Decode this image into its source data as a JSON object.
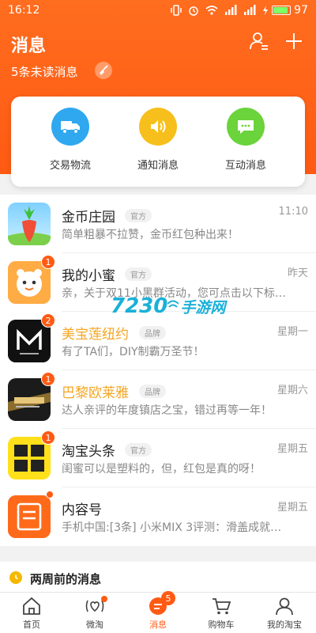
{
  "status_bar": {
    "time": "16:12",
    "battery": "97"
  },
  "header": {
    "title": "消息",
    "unread": "5条未读消息"
  },
  "quick_actions": [
    {
      "label": "交易物流",
      "color": "#2fa8f0",
      "icon": "truck-icon"
    },
    {
      "label": "通知消息",
      "color": "#f7bf1b",
      "icon": "speaker-icon"
    },
    {
      "label": "互动消息",
      "color": "#6bd33b",
      "icon": "chat-icon"
    }
  ],
  "messages": [
    {
      "name": "金币庄园",
      "tag": "官方",
      "time": "11:10",
      "preview": "简单粗暴不拉赞，金币红包种出来！",
      "badge": "",
      "dot": false,
      "highlight": false,
      "icon": "radish-icon"
    },
    {
      "name": "我的小蜜",
      "tag": "官方",
      "time": "昨天",
      "preview": "亲，关于双11小黑群活动，您可点击以下标…",
      "badge": "1",
      "dot": false,
      "highlight": false,
      "icon": "honey-mascot-icon"
    },
    {
      "name": "美宝莲纽约",
      "tag": "品牌",
      "time": "星期一",
      "preview": "有了TA们，DIY制霸万圣节！",
      "badge": "2",
      "dot": false,
      "highlight": true,
      "icon": "maybelline-logo-icon"
    },
    {
      "name": "巴黎欧莱雅",
      "tag": "品牌",
      "time": "星期六",
      "preview": "达人亲评的年度镇店之宝，错过再等一年！",
      "badge": "1",
      "dot": false,
      "highlight": true,
      "icon": "loreal-logo-icon"
    },
    {
      "name": "淘宝头条",
      "tag": "官方",
      "time": "星期五",
      "preview": "闺蜜可以是塑料的，但，红包是真的呀！",
      "badge": "1",
      "dot": false,
      "highlight": false,
      "icon": "taobao-headline-icon"
    },
    {
      "name": "内容号",
      "tag": "",
      "time": "星期五",
      "preview": "手机中国:[3条] 小米MIX 3评测：滑盖成就…",
      "badge": "",
      "dot": true,
      "highlight": false,
      "icon": "content-icon"
    }
  ],
  "section": {
    "title": "两周前的消息"
  },
  "watermark": {
    "number": "7230",
    "text": "手游网"
  },
  "tabs": [
    {
      "label": "首页",
      "active": false
    },
    {
      "label": "微淘",
      "active": false
    },
    {
      "label": "消息",
      "active": true,
      "badge": "5"
    },
    {
      "label": "购物车",
      "active": false
    },
    {
      "label": "我的淘宝",
      "active": false
    }
  ],
  "colors": {
    "accent": "#ff5a13",
    "brand_highlight": "#f5a623"
  }
}
